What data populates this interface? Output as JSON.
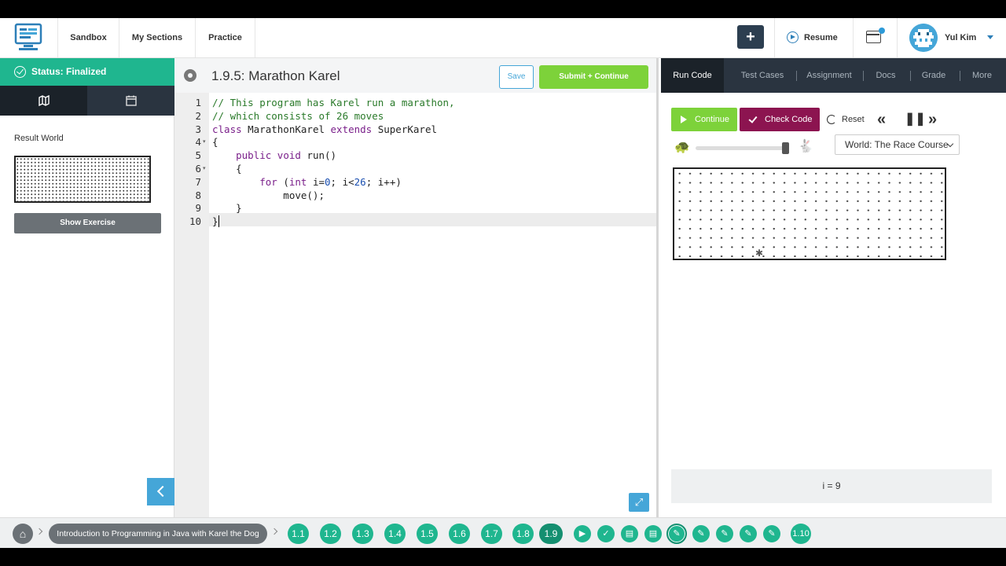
{
  "nav": {
    "links": [
      "Sandbox",
      "My Sections",
      "Practice"
    ],
    "plus_label": "+",
    "resume_label": "Resume",
    "user_name": "Yul Kim"
  },
  "left_panel": {
    "status": "Status: Finalized",
    "result_label": "Result World",
    "show_exercise_label": "Show Exercise"
  },
  "editor": {
    "title": "1.9.5: Marathon Karel",
    "save_label": "Save",
    "submit_label": "Submit + Continue",
    "line_numbers": [
      "1",
      "2",
      "3",
      "4",
      "5",
      "6",
      "7",
      "8",
      "9",
      "10"
    ],
    "lines": [
      [
        {
          "t": "// This program has Karel run a marathon,",
          "c": "cm"
        }
      ],
      [
        {
          "t": "// which consists of 26 moves",
          "c": "cm"
        }
      ],
      [
        {
          "t": "class ",
          "c": "kw"
        },
        {
          "t": "MarathonKarel ",
          "c": "tx"
        },
        {
          "t": "extends ",
          "c": "kw"
        },
        {
          "t": "SuperKarel",
          "c": "tx"
        }
      ],
      [
        {
          "t": "{",
          "c": "tx"
        }
      ],
      [
        {
          "t": "    public ",
          "c": "kw"
        },
        {
          "t": "void ",
          "c": "kw"
        },
        {
          "t": "run()",
          "c": "tx"
        }
      ],
      [
        {
          "t": "    {",
          "c": "tx"
        }
      ],
      [
        {
          "t": "        for ",
          "c": "kw"
        },
        {
          "t": "(",
          "c": "tx"
        },
        {
          "t": "int ",
          "c": "kw"
        },
        {
          "t": "i=",
          "c": "tx"
        },
        {
          "t": "0",
          "c": "num"
        },
        {
          "t": "; i<",
          "c": "tx"
        },
        {
          "t": "26",
          "c": "num"
        },
        {
          "t": "; i++)",
          "c": "tx"
        }
      ],
      [
        {
          "t": "            move();",
          "c": "tx"
        }
      ],
      [
        {
          "t": "    }",
          "c": "tx"
        }
      ],
      [
        {
          "t": "}",
          "c": "tx"
        }
      ]
    ]
  },
  "right_panel": {
    "tabs": [
      "Run Code",
      "Test Cases",
      "Assignment",
      "Docs",
      "Grade",
      "More"
    ],
    "continue_label": "Continue",
    "check_label": "Check Code",
    "reset_label": "Reset",
    "world_select": "World: The Race Course",
    "variable_display": "i = 9"
  },
  "bottom_bar": {
    "course_title": "Introduction to Programming in Java with Karel the Dog",
    "lessons": [
      "1.1",
      "1.2",
      "1.3",
      "1.4",
      "1.5",
      "1.6",
      "1.7",
      "1.8",
      "1.9"
    ],
    "activity_icons": [
      "video-icon",
      "check-icon",
      "document-icon",
      "document-icon",
      "pencil-icon",
      "pencil-icon",
      "pencil-icon",
      "pencil-icon",
      "pencil-icon"
    ],
    "next_lesson": "1.10"
  },
  "colors": {
    "green": "#1fb68f",
    "run_green": "#7dd23a",
    "check_maroon": "#8c1450",
    "accent_blue": "#45a6d8",
    "nav_dark": "#2a3440"
  }
}
